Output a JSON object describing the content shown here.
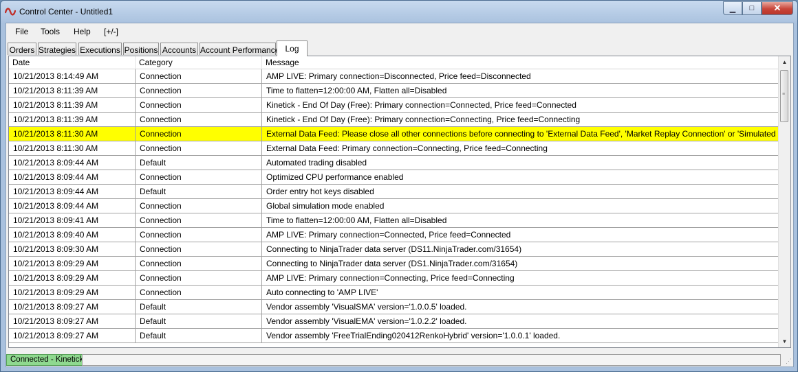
{
  "window": {
    "title": "Control Center - Untitled1",
    "minimize_label": "▁",
    "maximize_label": "□",
    "close_label": "✕"
  },
  "menu": {
    "file": "File",
    "tools": "Tools",
    "help": "Help",
    "expand": "[+/-]"
  },
  "tabs": [
    {
      "label": "Orders"
    },
    {
      "label": "Strategies"
    },
    {
      "label": "Executions"
    },
    {
      "label": "Positions"
    },
    {
      "label": "Accounts"
    },
    {
      "label": "Account Performance"
    },
    {
      "label": "Log"
    }
  ],
  "active_tab": "Log",
  "log": {
    "columns": [
      "Date",
      "Category",
      "Message"
    ],
    "highlight_color": "#ffff00",
    "rows": [
      {
        "date": "10/21/2013 8:14:49 AM",
        "category": "Connection",
        "message": "AMP LIVE: Primary connection=Disconnected, Price feed=Disconnected"
      },
      {
        "date": "10/21/2013 8:11:39 AM",
        "category": "Connection",
        "message": "Time to flatten=12:00:00 AM, Flatten all=Disabled"
      },
      {
        "date": "10/21/2013 8:11:39 AM",
        "category": "Connection",
        "message": "Kinetick - End Of Day (Free): Primary connection=Connected, Price feed=Connected"
      },
      {
        "date": "10/21/2013 8:11:39 AM",
        "category": "Connection",
        "message": "Kinetick - End Of Day (Free): Primary connection=Connecting, Price feed=Connecting"
      },
      {
        "date": "10/21/2013 8:11:30 AM",
        "category": "Connection",
        "message": "External Data Feed: Please close all other connections before connecting to 'External Data Feed', 'Market Replay Connection' or 'Simulated Data",
        "highlighted": true
      },
      {
        "date": "10/21/2013 8:11:30 AM",
        "category": "Connection",
        "message": "External Data Feed: Primary connection=Connecting, Price feed=Connecting"
      },
      {
        "date": "10/21/2013 8:09:44 AM",
        "category": "Default",
        "message": "Automated trading disabled"
      },
      {
        "date": "10/21/2013 8:09:44 AM",
        "category": "Connection",
        "message": "Optimized CPU performance enabled"
      },
      {
        "date": "10/21/2013 8:09:44 AM",
        "category": "Default",
        "message": "Order entry hot keys disabled"
      },
      {
        "date": "10/21/2013 8:09:44 AM",
        "category": "Connection",
        "message": "Global simulation mode enabled"
      },
      {
        "date": "10/21/2013 8:09:41 AM",
        "category": "Connection",
        "message": "Time to flatten=12:00:00 AM, Flatten all=Disabled"
      },
      {
        "date": "10/21/2013 8:09:40 AM",
        "category": "Connection",
        "message": "AMP LIVE: Primary connection=Connected, Price feed=Connected"
      },
      {
        "date": "10/21/2013 8:09:30 AM",
        "category": "Connection",
        "message": "Connecting to NinjaTrader data server (DS11.NinjaTrader.com/31654)"
      },
      {
        "date": "10/21/2013 8:09:29 AM",
        "category": "Connection",
        "message": "Connecting to NinjaTrader data server (DS1.NinjaTrader.com/31654)"
      },
      {
        "date": "10/21/2013 8:09:29 AM",
        "category": "Connection",
        "message": "AMP LIVE: Primary connection=Connecting, Price feed=Connecting"
      },
      {
        "date": "10/21/2013 8:09:29 AM",
        "category": "Connection",
        "message": "Auto connecting to 'AMP LIVE'"
      },
      {
        "date": "10/21/2013 8:09:27 AM",
        "category": "Default",
        "message": "Vendor assembly 'VisualSMA' version='1.0.0.5' loaded."
      },
      {
        "date": "10/21/2013 8:09:27 AM",
        "category": "Default",
        "message": "Vendor assembly 'VisualEMA' version='1.0.2.2' loaded."
      },
      {
        "date": "10/21/2013 8:09:27 AM",
        "category": "Default",
        "message": "Vendor assembly 'FreeTrialEnding020412RenkoHybrid' version='1.0.0.1' loaded."
      }
    ]
  },
  "status": {
    "connection": "Connected - Kinetick",
    "connection_color": "#8fd98f"
  }
}
